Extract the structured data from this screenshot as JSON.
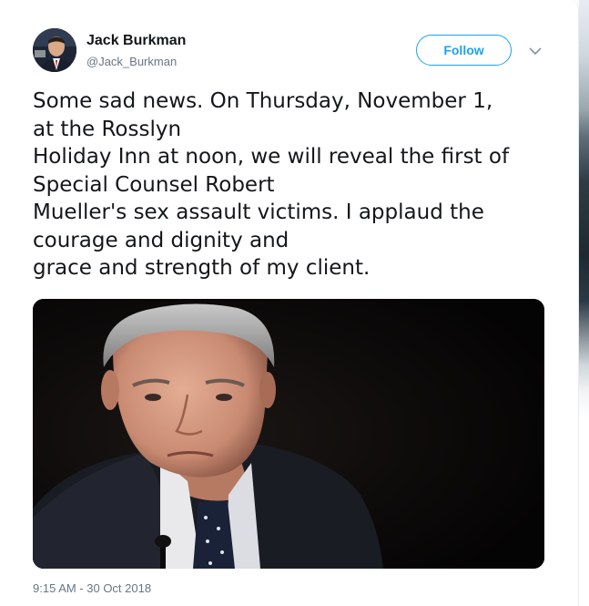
{
  "tweet": {
    "author": {
      "name": "Jack Burkman",
      "handle": "@Jack_Burkman",
      "avatar_icon": "profile-photo"
    },
    "follow_label": "Follow",
    "more_icon": "chevron-down-icon",
    "text_lines": [
      "Some sad news.  On Thursday, November 1,",
      "at the Rosslyn",
      "Holiday Inn at noon, we will reveal the first of",
      "Special Counsel Robert",
      "Mueller's sex assault victims. I applaud the",
      "courage and dignity and",
      "grace and strength of my client."
    ],
    "media": {
      "kind": "photo"
    },
    "timestamp": "9:15 AM - 30 Oct 2018"
  },
  "colors": {
    "accent": "#1da1f2",
    "text": "#14171a",
    "secondary_text": "#657786"
  }
}
